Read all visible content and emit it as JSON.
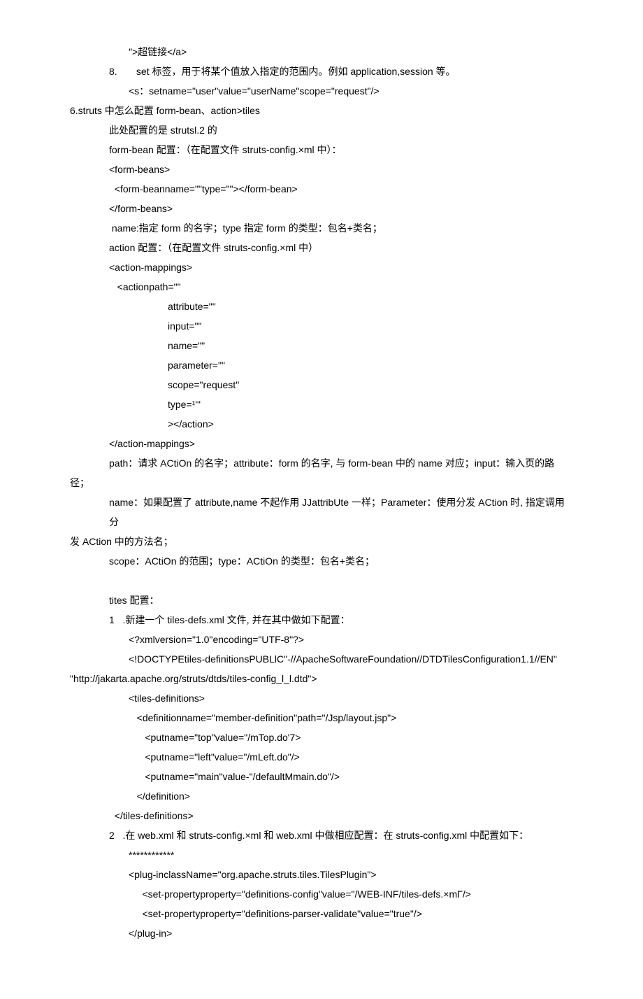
{
  "lines": [
    {
      "indent": 3,
      "text": "″>超链接</a>"
    },
    {
      "indent": 2,
      "text": "8.       set 标签，用于将某个值放入指定的范围内。例如 application,session 等。"
    },
    {
      "indent": 3,
      "text": "<s：setname=\"user\"value=\"userName\"scope=\"request\"/>"
    },
    {
      "indent": 0,
      "text": "6.struts 中怎么配置 form-bean、action>tiles"
    },
    {
      "indent": 2,
      "text": "此处配置的是 strutsl.2 的"
    },
    {
      "indent": 2,
      "text": "form-bean 配置：（在配置文件 struts-config.×ml 中）："
    },
    {
      "indent": 2,
      "text": "<form-beans>"
    },
    {
      "indent": 2,
      "text": "  <form-beanname=\"\"type=\"\"></form-bean>"
    },
    {
      "indent": 2,
      "text": "</form-beans>"
    },
    {
      "indent": 2,
      "text": " name:指定 form 的名字；type 指定 form 的类型：包名+类名；"
    },
    {
      "indent": 2,
      "text": "action 配置：（在配置文件 struts-config.×ml 中）"
    },
    {
      "indent": 2,
      "text": "<action-mappings>"
    },
    {
      "indent": 2,
      "text": "   <actionpath=\"\""
    },
    {
      "indent": 5,
      "text": "attribute=\"\""
    },
    {
      "indent": 5,
      "text": "input=\"\""
    },
    {
      "indent": 5,
      "text": "name=\"\""
    },
    {
      "indent": 5,
      "text": "parameter=\"\""
    },
    {
      "indent": 5,
      "text": "scope=\"request\""
    },
    {
      "indent": 5,
      "text": "type=¹'\""
    },
    {
      "indent": 5,
      "text": "></action>"
    },
    {
      "indent": 2,
      "text": "</action-mappings>"
    },
    {
      "indent": 2,
      "text": "path：请求 ACtiOn 的名字；attribute：form 的名字, 与 form-bean 中的 name 对应；input：输入页的路"
    },
    {
      "indent": 0,
      "text": "径；"
    },
    {
      "indent": 2,
      "text": "name：如果配置了 attribute,name 不起作用 JJattribUte 一样；Parameter：使用分发 ACtion 时, 指定调用分"
    },
    {
      "indent": 0,
      "text": "发 ACtion 中的方法名；"
    },
    {
      "indent": 2,
      "text": "scope：ACtiOn 的范围；type：ACtiOn 的类型：包名+类名；"
    },
    {
      "indent": 2,
      "text": " "
    },
    {
      "indent": 2,
      "text": "tites 配置："
    },
    {
      "indent": 2,
      "text": "1   .新建一个 tiles-defs.xml 文件, 并在其中做如下配置："
    },
    {
      "indent": 3,
      "text": "<?xmlversion=\"1.0\"encoding=\"UTF-8\"?>"
    },
    {
      "indent": 3,
      "text": "<!DOCTYPEtiles-definitionsPUBLlC\"-//ApacheSoftwareFoundation//DTDTilesConfiguration1.1//EN\""
    },
    {
      "indent": 0,
      "text": "\"http://jakarta.apache.org/struts/dtds/tiles-config_l_l.dtd\">"
    },
    {
      "indent": 3,
      "text": "<tiles-definitions>"
    },
    {
      "indent": 3,
      "text": "   <definitionname=\"member-definition\"path=\"/Jsp/layout.jsp\">"
    },
    {
      "indent": 3,
      "text": "      <putname=\"top\"value=\"/mTop.do'7>"
    },
    {
      "indent": 3,
      "text": "      <putname=\"left\"value=\"/mLeft.do\"/>"
    },
    {
      "indent": 3,
      "text": "      <putname=\"main\"value-\"/defaultMmain.do\"/>"
    },
    {
      "indent": 3,
      "text": "   </definition>"
    },
    {
      "indent": 2,
      "text": "  </tiles-definitions>"
    },
    {
      "indent": 2,
      "text": "2   .在 web.xml 和 struts-config.×ml 和 web.xml 中做相应配置：在 struts-config.xml 中配置如下："
    },
    {
      "indent": 3,
      "text": "************"
    },
    {
      "indent": 3,
      "text": "<plug-inclassName=\"org.apache.struts.tiles.TilesPlugin\">"
    },
    {
      "indent": 3,
      "text": "     <set-propertyproperty=\"definitions-config\"value=\"/WEB-INF/tiles-defs.×mΓ/>"
    },
    {
      "indent": 3,
      "text": "     <set-propertyproperty=\"definitions-parser-validate\"value=\"true\"/>"
    },
    {
      "indent": 3,
      "text": "</plug-in>"
    }
  ]
}
